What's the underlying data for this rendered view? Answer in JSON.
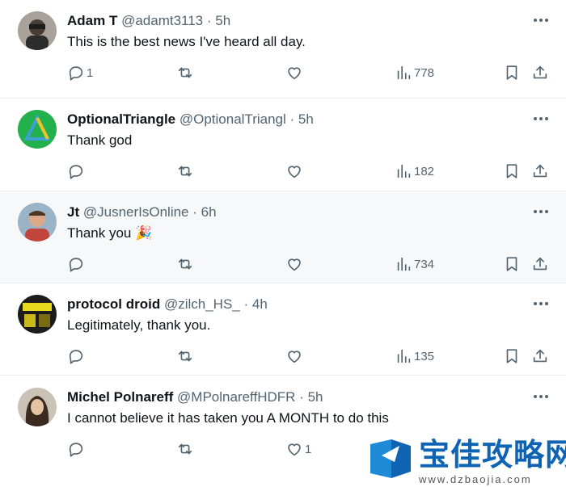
{
  "replies": [
    {
      "name": "Adam T",
      "handle": "@adamt3113",
      "dot": "·",
      "time": "5h",
      "text": "This is the best news I've heard all day.",
      "reply_count": "1",
      "retweet_count": "",
      "like_count": "",
      "views": "778"
    },
    {
      "name": "OptionalTriangle",
      "handle": "@OptionalTriangl",
      "dot": "·",
      "time": "5h",
      "text": "Thank god",
      "reply_count": "",
      "retweet_count": "",
      "like_count": "",
      "views": "182"
    },
    {
      "name": "Jt",
      "handle": "@JusnerIsOnline",
      "dot": "·",
      "time": "6h",
      "text": "Thank you",
      "emoji": "🎉",
      "reply_count": "",
      "retweet_count": "",
      "like_count": "",
      "views": "734"
    },
    {
      "name": "protocol droid",
      "handle": "@zilch_HS_",
      "dot": "·",
      "time": "4h",
      "text": "Legitimately, thank you.",
      "reply_count": "",
      "retweet_count": "",
      "like_count": "",
      "views": "135"
    },
    {
      "name": "Michel Polnareff",
      "handle": "@MPolnareffHDFR",
      "dot": "·",
      "time": "5h",
      "text": "I cannot believe it has taken you A MONTH to do this",
      "reply_count": "",
      "retweet_count": "",
      "like_count": "1",
      "views": ""
    }
  ],
  "icons": {
    "reply": "reply-icon",
    "retweet": "retweet-icon",
    "like": "heart-icon",
    "views": "views-chart-icon",
    "bookmark": "bookmark-icon",
    "share": "share-icon",
    "more": "more-dots-icon"
  },
  "watermark": {
    "title": "宝佳攻略网",
    "url": "www.dzbaojia.com"
  },
  "colors": {
    "text": "#0f1419",
    "secondary": "#536471",
    "highlight_bg": "#f7f8f9",
    "watermark_blue": "#0e63b3"
  }
}
